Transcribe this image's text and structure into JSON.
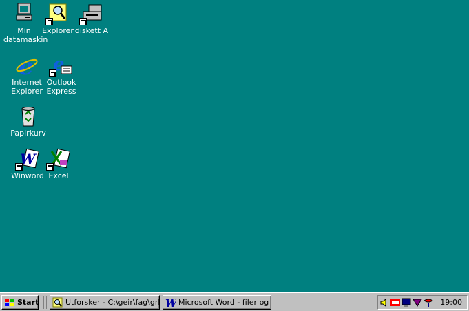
{
  "desktop": {
    "icons": [
      {
        "label": "Min datamaskin",
        "icon": "computer-icon"
      },
      {
        "label": "Explorer",
        "icon": "explorer-magnifier-icon"
      },
      {
        "label": "diskett A",
        "icon": "floppy-icon"
      },
      {
        "label": "Internet Explorer",
        "icon": "internet-explorer-icon"
      },
      {
        "label": "Outlook Express",
        "icon": "outlook-express-icon"
      },
      {
        "label": "Papirkurv",
        "icon": "recycle-bin-icon"
      },
      {
        "label": "Winword",
        "icon": "word-icon"
      },
      {
        "label": "Excel",
        "icon": "excel-icon"
      }
    ]
  },
  "taskbar": {
    "start_label": "Start",
    "tasks": [
      {
        "label": "Utforsker - C:\\geir\\fag\\grk-...",
        "icon": "explorer-magnifier-icon"
      },
      {
        "label": "Microsoft Word - filer og m...",
        "icon": "word-icon"
      }
    ],
    "tray": {
      "icons": [
        "speaker-icon",
        "telenor-icon",
        "monitor-icon",
        "network-icon",
        "chat-icon"
      ],
      "clock": "19:00"
    }
  },
  "colors": {
    "desktop": "#008080",
    "taskbar": "#c0c0c0"
  }
}
